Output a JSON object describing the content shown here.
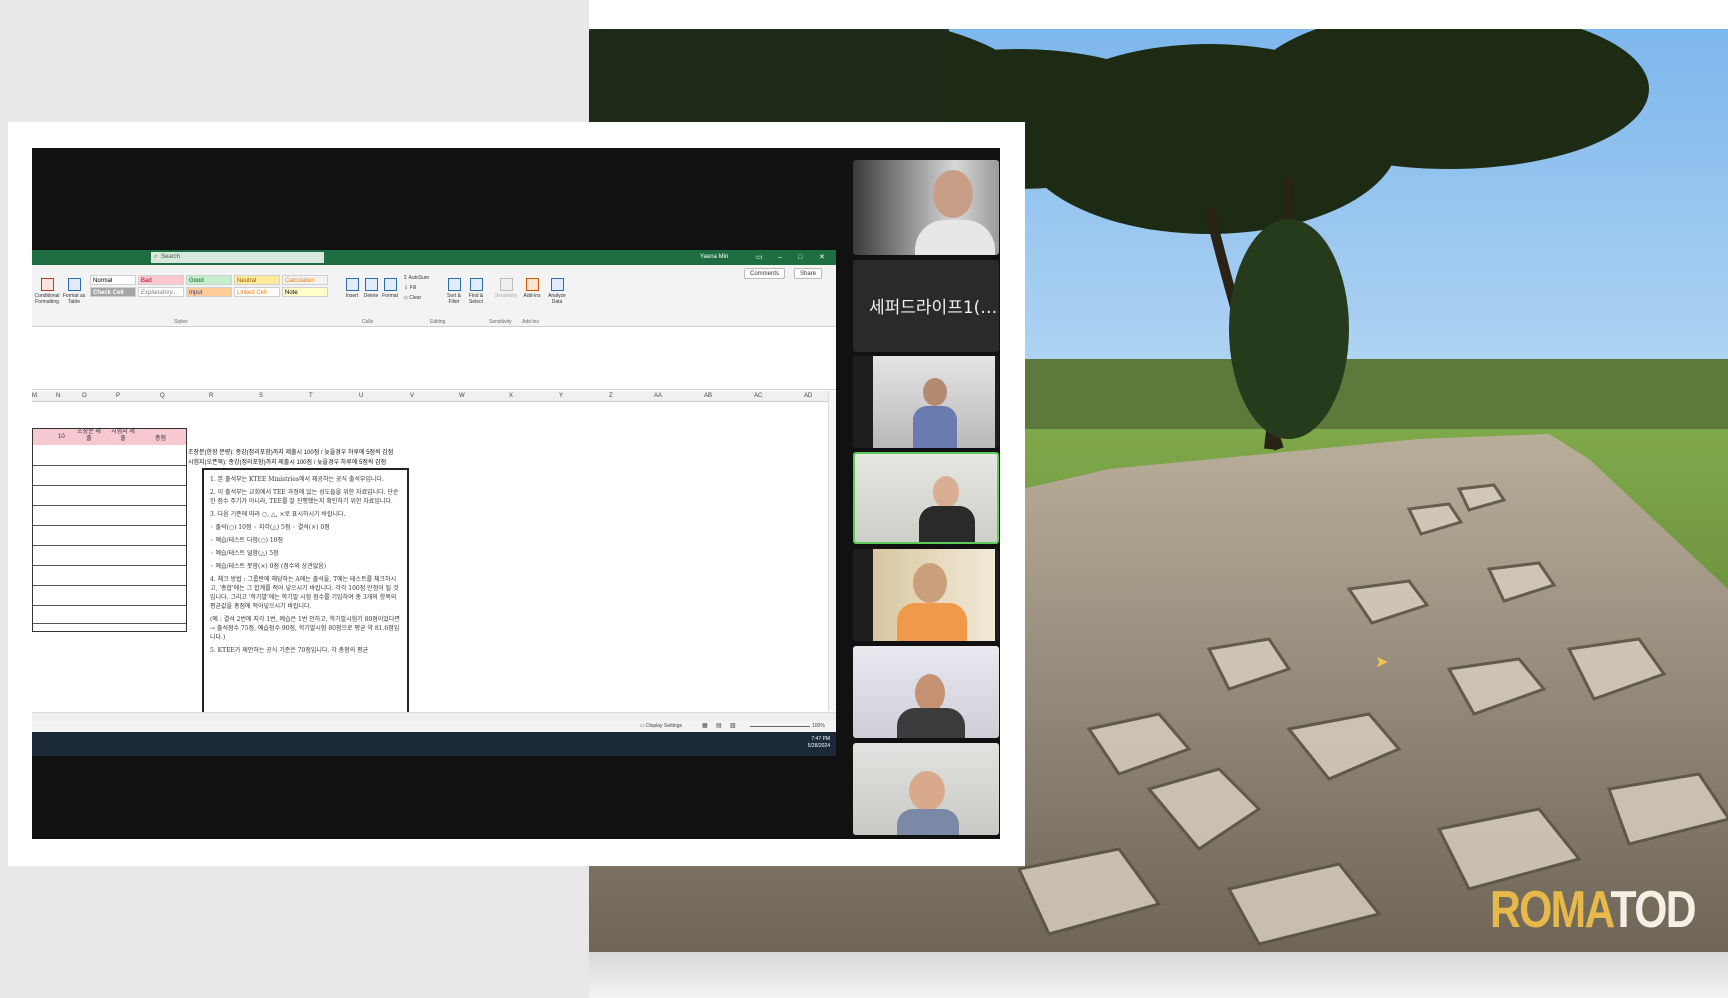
{
  "excel": {
    "search_placeholder": "Search",
    "user_name": "Yaena Min",
    "comments_label": "Comments",
    "share_label": "Share",
    "styles": {
      "normal": "Normal",
      "bad": "Bad",
      "good": "Good",
      "neutral": "Neutral",
      "calculation": "Calculation",
      "check_cell": "Check Cell",
      "explanatory": "Explanatory...",
      "input": "Input",
      "linked_cell": "Linked Cell",
      "note": "Note"
    },
    "ribbon": {
      "conditional_formatting": "Conditional Formatting",
      "format_as_table": "Format as Table",
      "insert": "Insert",
      "delete": "Delete",
      "format": "Format",
      "autosum": "AutoSum",
      "fill": "Fill",
      "clear": "Clear",
      "sort_filter": "Sort & Filter",
      "find_select": "Find & Select",
      "sensitivity": "Sensitivity",
      "add_ins": "Add-ins",
      "analyze_data": "Analyze Data",
      "groups": {
        "styles": "Styles",
        "cells": "Cells",
        "editing": "Editing",
        "sensitivity": "Sensitivity",
        "add_ins": "Add-ins"
      }
    },
    "columns": [
      "M",
      "N",
      "O",
      "P",
      "Q",
      "R",
      "S",
      "T",
      "U",
      "V",
      "W",
      "X",
      "Y",
      "Z",
      "AA",
      "AB",
      "AC",
      "AD"
    ],
    "table_header": {
      "col_10": "10",
      "study": "조장분 제출",
      "exam": "시험지 제출",
      "total": "총점"
    },
    "notes": [
      "조장분(한장 분량): 종강(정리포함)까지 제출시 100점 / 늦을경우 하루에 5점씩 감점",
      "시험지(오픈북): 종강(정리포함)까지 제출시 100점 / 늦을경우 하루에 5점씩 감점"
    ],
    "box_items": [
      "1.  본 출석부는 KTEE Ministries에서 제공하는 공식 출석부입니다.",
      "2.  이 출석부는 교회에서 TEE 과정에 있는 성도들을 위한 자료입니다. 단순한 점수 주기가 아니라, TEE를 잘 진행했는지 확인하기 위한 자료입니다.",
      "3.  다음 기준에 따라 ○, △, ×로 표시하시기 바랍니다.",
      "   ◦ 출석(○) 10점    ◦ 지각(△) 5점    ◦ 결석(×) 0점",
      "   ◦ 예습/테스트 다함(○) 10점",
      "   ◦ 예습/테스트 덜함(△) 5점",
      "   ◦ 예습/테스트 못함(×) 0점 (점수와 상관없음)",
      "4.  체크 방법 : 그룹란에 해당하는 A에는 출석을, T에는 테스트를 체크하시고, '총합'에는 그 합계를 적어 넣으시기 바랍니다. 각각 100점 만점이 될 것입니다. 그리고 '학기말'에는 학기말 시험 점수를 기입하여 총 3개의 항목의 평균값을 총점에 적어넣으시기 바랍니다.",
      "   (예 : 결석 2번에 지각 1번, 예습은 1번 안하고, 학기말시험기 80점이었다면 → 출석점수 75점, 예습점수 90점, 학기말시험 80점으로 평균 약 81.6점입니다.)",
      "5.  KTEE가 제안하는 공식 기준은 70점입니다. 각 총점의 평균"
    ],
    "status_display_settings": "Display Settings",
    "zoom": "100%",
    "time": "7:47 PM",
    "date": "5/28/2024"
  },
  "participants": {
    "name_tile": "세퍼드라이프1(…"
  },
  "background": {
    "logo_main": "ROMA",
    "logo_tail": "TOD"
  },
  "colors": {
    "excel_green": "#1f6e43",
    "active_speaker": "#5bcb5a",
    "logo_gold": "#e6b94a"
  }
}
